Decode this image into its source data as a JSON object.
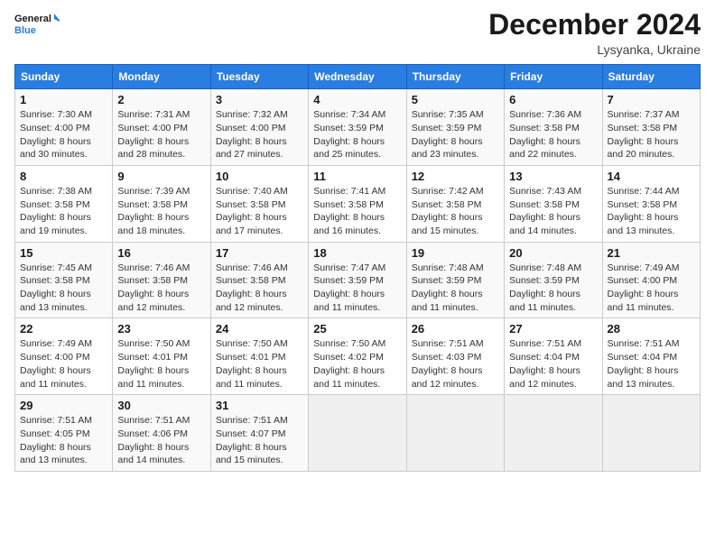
{
  "logo": {
    "line1": "General",
    "line2": "Blue"
  },
  "title": "December 2024",
  "subtitle": "Lysyanka, Ukraine",
  "weekdays": [
    "Sunday",
    "Monday",
    "Tuesday",
    "Wednesday",
    "Thursday",
    "Friday",
    "Saturday"
  ],
  "weeks": [
    [
      {
        "day": "1",
        "sunrise": "7:30 AM",
        "sunset": "4:00 PM",
        "daylight": "8 hours and 30 minutes."
      },
      {
        "day": "2",
        "sunrise": "7:31 AM",
        "sunset": "4:00 PM",
        "daylight": "8 hours and 28 minutes."
      },
      {
        "day": "3",
        "sunrise": "7:32 AM",
        "sunset": "4:00 PM",
        "daylight": "8 hours and 27 minutes."
      },
      {
        "day": "4",
        "sunrise": "7:34 AM",
        "sunset": "3:59 PM",
        "daylight": "8 hours and 25 minutes."
      },
      {
        "day": "5",
        "sunrise": "7:35 AM",
        "sunset": "3:59 PM",
        "daylight": "8 hours and 23 minutes."
      },
      {
        "day": "6",
        "sunrise": "7:36 AM",
        "sunset": "3:58 PM",
        "daylight": "8 hours and 22 minutes."
      },
      {
        "day": "7",
        "sunrise": "7:37 AM",
        "sunset": "3:58 PM",
        "daylight": "8 hours and 20 minutes."
      }
    ],
    [
      {
        "day": "8",
        "sunrise": "7:38 AM",
        "sunset": "3:58 PM",
        "daylight": "8 hours and 19 minutes."
      },
      {
        "day": "9",
        "sunrise": "7:39 AM",
        "sunset": "3:58 PM",
        "daylight": "8 hours and 18 minutes."
      },
      {
        "day": "10",
        "sunrise": "7:40 AM",
        "sunset": "3:58 PM",
        "daylight": "8 hours and 17 minutes."
      },
      {
        "day": "11",
        "sunrise": "7:41 AM",
        "sunset": "3:58 PM",
        "daylight": "8 hours and 16 minutes."
      },
      {
        "day": "12",
        "sunrise": "7:42 AM",
        "sunset": "3:58 PM",
        "daylight": "8 hours and 15 minutes."
      },
      {
        "day": "13",
        "sunrise": "7:43 AM",
        "sunset": "3:58 PM",
        "daylight": "8 hours and 14 minutes."
      },
      {
        "day": "14",
        "sunrise": "7:44 AM",
        "sunset": "3:58 PM",
        "daylight": "8 hours and 13 minutes."
      }
    ],
    [
      {
        "day": "15",
        "sunrise": "7:45 AM",
        "sunset": "3:58 PM",
        "daylight": "8 hours and 13 minutes."
      },
      {
        "day": "16",
        "sunrise": "7:46 AM",
        "sunset": "3:58 PM",
        "daylight": "8 hours and 12 minutes."
      },
      {
        "day": "17",
        "sunrise": "7:46 AM",
        "sunset": "3:58 PM",
        "daylight": "8 hours and 12 minutes."
      },
      {
        "day": "18",
        "sunrise": "7:47 AM",
        "sunset": "3:59 PM",
        "daylight": "8 hours and 11 minutes."
      },
      {
        "day": "19",
        "sunrise": "7:48 AM",
        "sunset": "3:59 PM",
        "daylight": "8 hours and 11 minutes."
      },
      {
        "day": "20",
        "sunrise": "7:48 AM",
        "sunset": "3:59 PM",
        "daylight": "8 hours and 11 minutes."
      },
      {
        "day": "21",
        "sunrise": "7:49 AM",
        "sunset": "4:00 PM",
        "daylight": "8 hours and 11 minutes."
      }
    ],
    [
      {
        "day": "22",
        "sunrise": "7:49 AM",
        "sunset": "4:00 PM",
        "daylight": "8 hours and 11 minutes."
      },
      {
        "day": "23",
        "sunrise": "7:50 AM",
        "sunset": "4:01 PM",
        "daylight": "8 hours and 11 minutes."
      },
      {
        "day": "24",
        "sunrise": "7:50 AM",
        "sunset": "4:01 PM",
        "daylight": "8 hours and 11 minutes."
      },
      {
        "day": "25",
        "sunrise": "7:50 AM",
        "sunset": "4:02 PM",
        "daylight": "8 hours and 11 minutes."
      },
      {
        "day": "26",
        "sunrise": "7:51 AM",
        "sunset": "4:03 PM",
        "daylight": "8 hours and 12 minutes."
      },
      {
        "day": "27",
        "sunrise": "7:51 AM",
        "sunset": "4:04 PM",
        "daylight": "8 hours and 12 minutes."
      },
      {
        "day": "28",
        "sunrise": "7:51 AM",
        "sunset": "4:04 PM",
        "daylight": "8 hours and 13 minutes."
      }
    ],
    [
      {
        "day": "29",
        "sunrise": "7:51 AM",
        "sunset": "4:05 PM",
        "daylight": "8 hours and 13 minutes."
      },
      {
        "day": "30",
        "sunrise": "7:51 AM",
        "sunset": "4:06 PM",
        "daylight": "8 hours and 14 minutes."
      },
      {
        "day": "31",
        "sunrise": "7:51 AM",
        "sunset": "4:07 PM",
        "daylight": "8 hours and 15 minutes."
      },
      null,
      null,
      null,
      null
    ]
  ],
  "labels": {
    "sunrise": "Sunrise:",
    "sunset": "Sunset:",
    "daylight": "Daylight:"
  }
}
